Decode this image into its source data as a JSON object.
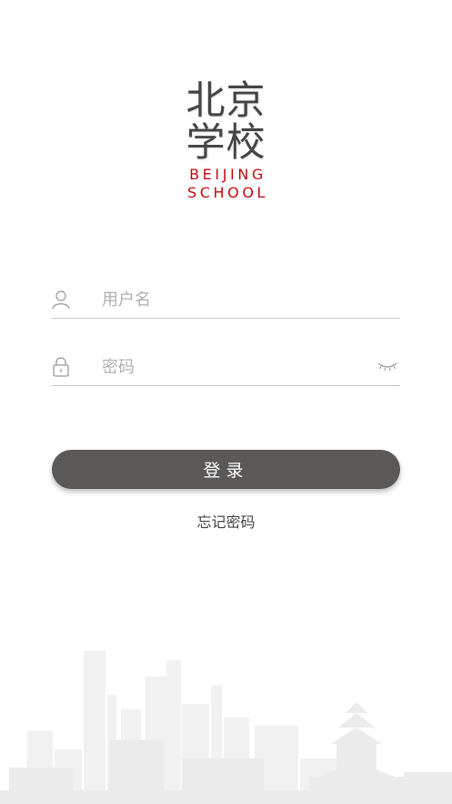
{
  "logo": {
    "line1": "北京",
    "line2": "学校",
    "english_line1": "BEIJING",
    "english_line2": "SCHOOL",
    "english_color": "#c40a10"
  },
  "form": {
    "username_placeholder": "用户名",
    "password_placeholder": "密码",
    "user_icon": "user-icon",
    "lock_icon": "lock-icon",
    "eye_icon": "eye-closed-icon"
  },
  "login_button": {
    "label": "登录",
    "color": "#5a5958"
  },
  "forgot_password": "忘记密码",
  "background": {
    "image": "beijing-skyline-illustration"
  }
}
